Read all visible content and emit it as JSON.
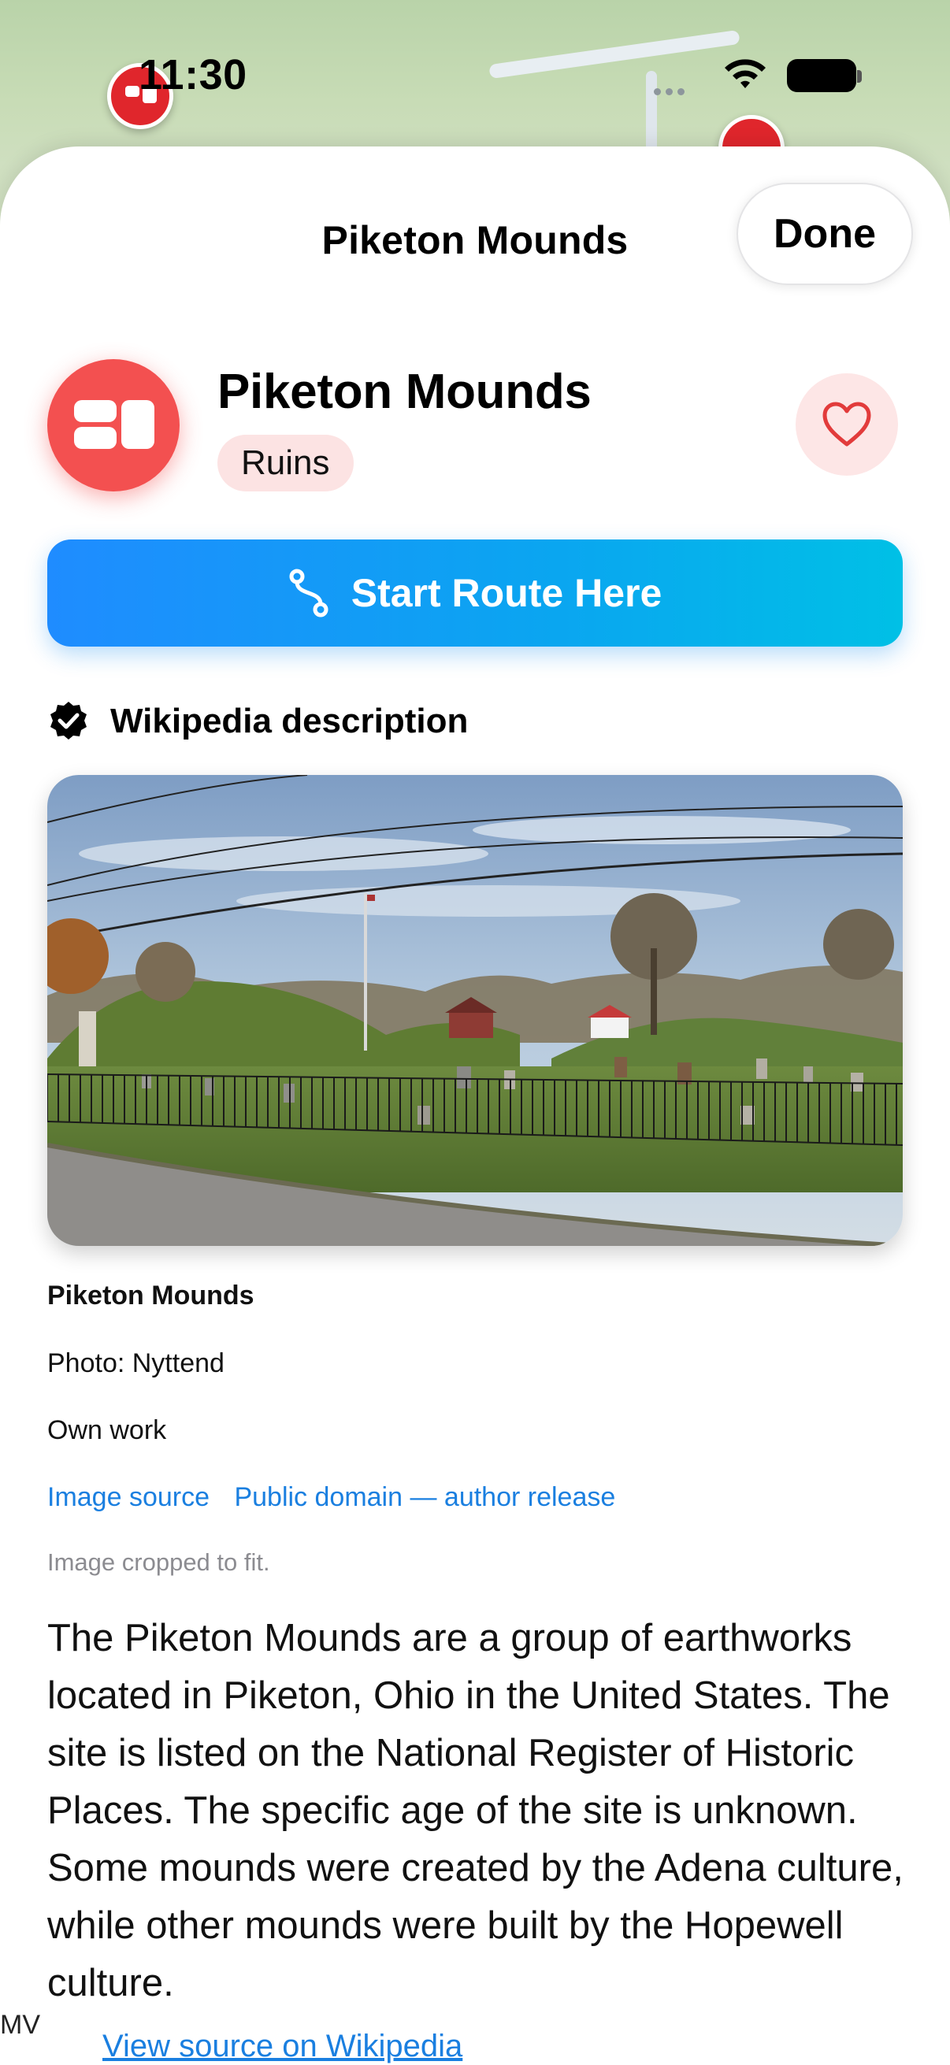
{
  "status_bar": {
    "time": "11:30"
  },
  "sheet": {
    "title": "Piketon Mounds",
    "done_label": "Done"
  },
  "place": {
    "name": "Piketon Mounds",
    "category": "Ruins",
    "category_icon": "ruins-icon",
    "accent_color": "#F35050"
  },
  "actions": {
    "route_label": "Start Route Here",
    "route_icon": "route-icon",
    "favorite_icon": "heart-icon"
  },
  "wikipedia": {
    "header_label": "Wikipedia description",
    "photo_title": "Piketon Mounds",
    "photo_credit": "Photo: Nyttend",
    "photo_note": "Own work",
    "links": [
      "Image source",
      "Public domain — author release"
    ],
    "crop_note": "Image cropped to fit.",
    "description": "The Piketon Mounds are a group of earthworks located in Piketon, Ohio in the United States. The site is listed on the National Register of Historic Places. The specific age of the site is unknown. Some mounds were created by the Adena culture, while other mounds were built by the Hopewell culture.",
    "source_link": "View source on Wikipedia"
  },
  "map": {
    "corner_label": "MV",
    "pin_color": "#E0262C"
  }
}
